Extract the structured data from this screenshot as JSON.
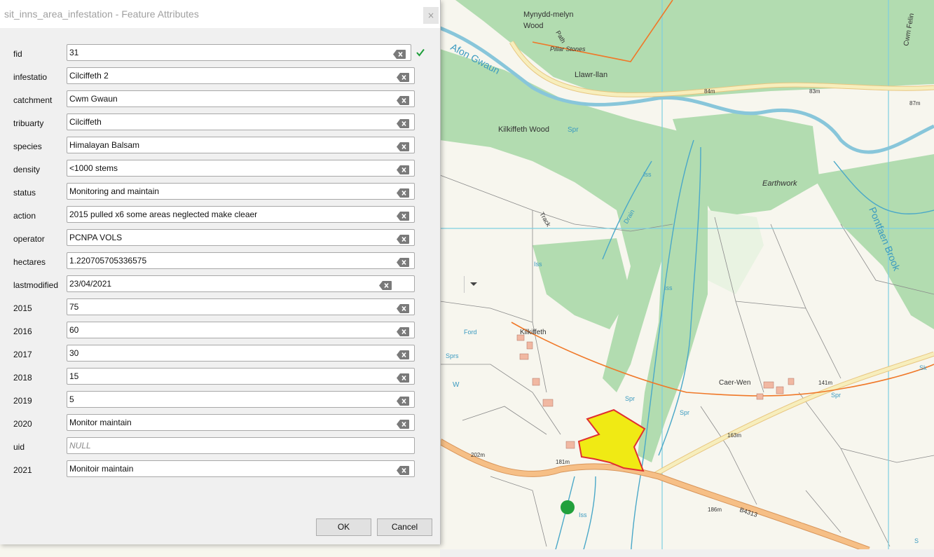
{
  "dialog": {
    "title": "sit_inns_area_infestation - Feature Attributes",
    "close_label": "×",
    "ok_label": "OK",
    "cancel_label": "Cancel"
  },
  "fields": [
    {
      "label": "fid",
      "value": "31"
    },
    {
      "label": "infestatio",
      "value": "Cilciffeth 2"
    },
    {
      "label": "catchment",
      "value": "Cwm Gwaun"
    },
    {
      "label": "tribuarty",
      "value": "Cilciffeth"
    },
    {
      "label": "species",
      "value": "Himalayan Balsam"
    },
    {
      "label": "density",
      "value": "<1000 stems"
    },
    {
      "label": "status",
      "value": "Monitoring and maintain"
    },
    {
      "label": "action",
      "value": "2015 pulled x6 some areas neglected make cleaer"
    },
    {
      "label": "operator",
      "value": "PCNPA VOLS"
    },
    {
      "label": "hectares",
      "value": "1.220705705336575"
    },
    {
      "label": "lastmodified",
      "value": "23/04/2021"
    },
    {
      "label": "2015",
      "value": "75"
    },
    {
      "label": "2016",
      "value": "60"
    },
    {
      "label": "2017",
      "value": "30"
    },
    {
      "label": "2018",
      "value": "15"
    },
    {
      "label": "2019",
      "value": "5"
    },
    {
      "label": "2020",
      "value": "Monitor maintain"
    },
    {
      "label": "uid",
      "value": "NULL"
    },
    {
      "label": "2021",
      "value": "Monitoir maintain"
    }
  ],
  "map": {
    "labels": {
      "mynydd": "Mynydd-melyn",
      "wood": "Wood",
      "path": "Path",
      "pillar": "Pillar Stones",
      "afon": "Afon Gwaun",
      "llawr": "Llawr-llan",
      "kilkiffeth_wood": "Kilkiffeth Wood",
      "spr1": "Spr",
      "earthwork": "Earthwork",
      "iss1": "Iss",
      "drain": "Drain",
      "track": "Track",
      "iss2": "Iss",
      "iss3": "Iss",
      "pontfaen": "Pontfaen Brook",
      "m84": "84m",
      "m83": "83m",
      "m87": "87m",
      "cwm_felin": "Cwm Felin",
      "kilkiffeth": "Kilkiffeth",
      "ford": "Ford",
      "sprs": "Sprs",
      "w": "W",
      "caer_wen": "Caer-Wen",
      "m141": "141m",
      "spr2": "Spr",
      "spr3": "Spr",
      "spr4": "Spr",
      "m163": "163m",
      "m202": "202m",
      "m181": "181m",
      "iss4": "Iss",
      "m186": "186m",
      "b4313": "B4313",
      "sk": "Sk",
      "ss": "S"
    },
    "colors": {
      "woodland": "#a6d8a6",
      "field": "#fafaf5",
      "water": "#5aaec8",
      "road_major": "#f4b77c",
      "road_minor": "#f5e6a3",
      "boundary": "#f07828",
      "infestation": "#f0ea14",
      "infestation_edge": "#e03030",
      "marker": "#22a03c",
      "grid": "#7ecfe0"
    }
  }
}
